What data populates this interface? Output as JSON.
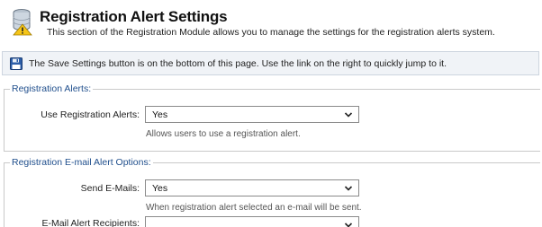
{
  "header": {
    "title": "Registration Alert Settings",
    "subtitle": "This section of the Registration Module allows you to manage the settings for the registration alerts system."
  },
  "notice": {
    "text": "The Save Settings button is on the bottom of this page. Use the link on the right to quickly jump to it."
  },
  "sections": {
    "alerts": {
      "legend": "Registration Alerts:",
      "use_label": "Use Registration Alerts:",
      "use_value": "Yes",
      "use_help": "Allows users to use a registration alert."
    },
    "email": {
      "legend": "Registration E-mail Alert Options:",
      "send_label": "Send E-Mails:",
      "send_value": "Yes",
      "send_help": "When registration alert selected an e-mail will be sent.",
      "recipients_label": "E-Mail Alert Recipients:"
    }
  },
  "colors": {
    "legend_text": "#1f4e8c",
    "notice_bg": "#f0f3f7"
  }
}
